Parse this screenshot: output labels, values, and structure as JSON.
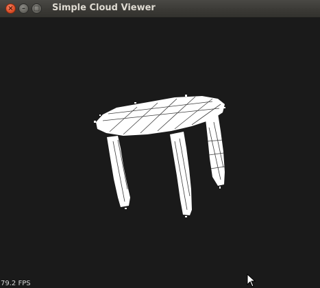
{
  "window": {
    "title": "Simple Cloud Viewer",
    "buttons": {
      "close_icon": "close-icon",
      "minimize_icon": "minimize-icon",
      "maximize_icon": "maximize-icon"
    }
  },
  "viewport": {
    "background": "#1a1a1a",
    "point_color": "#ffffff",
    "fps_label": "79.2 FPS"
  }
}
